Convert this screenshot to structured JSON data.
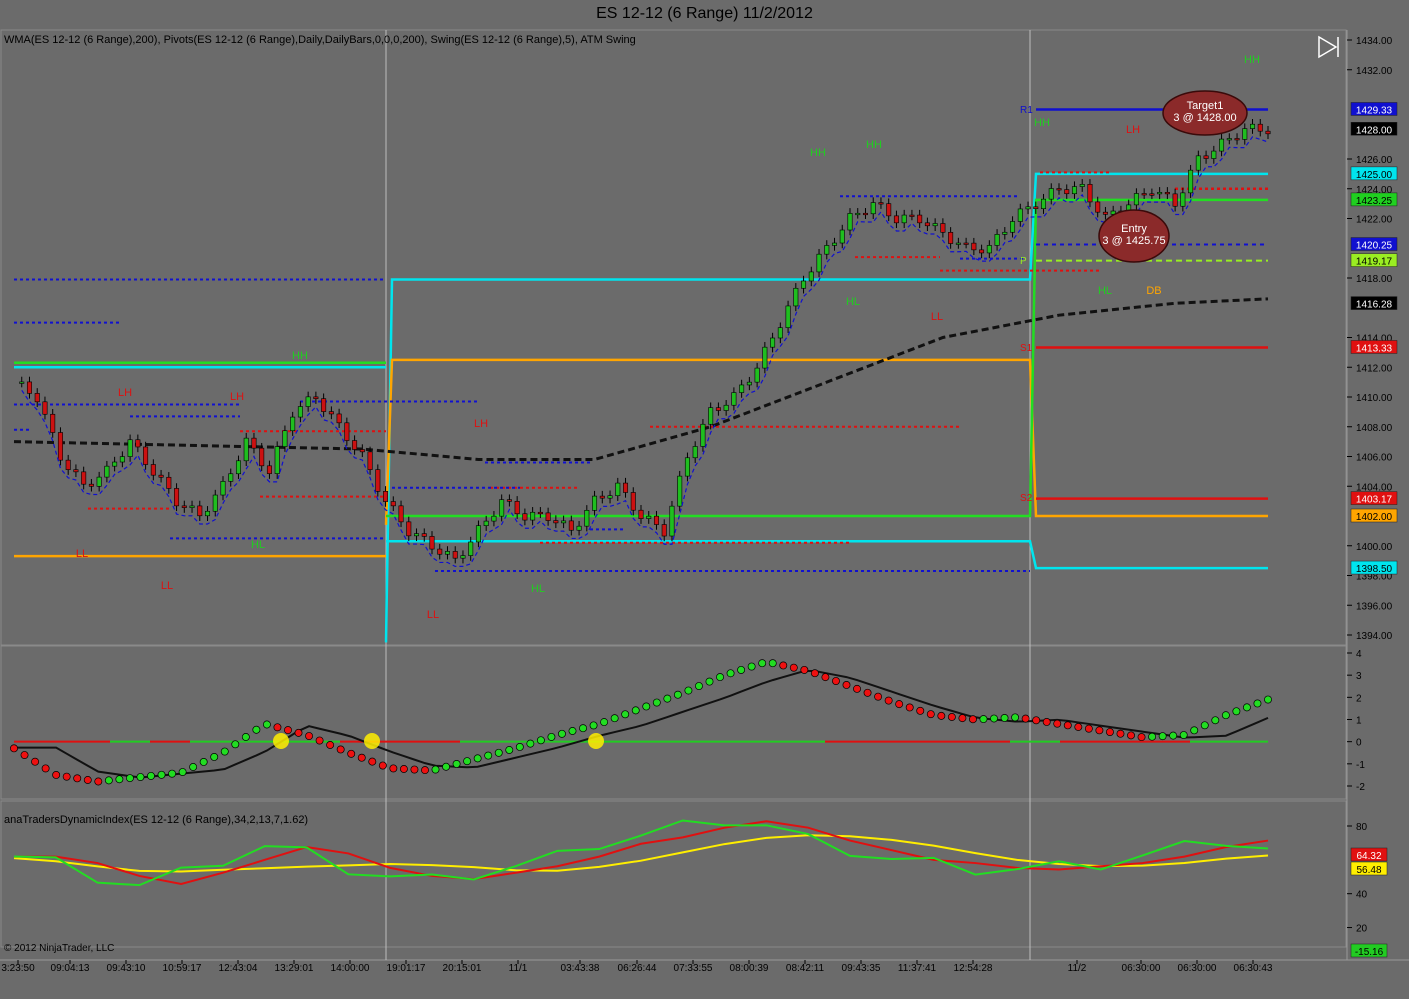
{
  "window": {
    "title": "ES 12-12 (6 Range)  11/2/2012"
  },
  "panel1": {
    "indicator_label": "WMA(ES 12-12 (6 Range),200), Pivots(ES 12-12 (6 Range),Daily,DailyBars,0,0,0,200), Swing(ES 12-12 (6 Range),5), ATM Swing",
    "price_ticks": [
      "1434.00",
      "1432.00",
      "1426.00",
      "1424.00",
      "1422.00",
      "1418.00",
      "1414.00",
      "1412.00",
      "1410.00",
      "1408.00",
      "1406.00",
      "1404.00",
      "1400.00",
      "1398.00",
      "1396.00",
      "1394.00"
    ],
    "price_ticks_values": [
      1434,
      1432,
      1426,
      1424,
      1422,
      1418,
      1414,
      1412,
      1410,
      1408,
      1406,
      1404,
      1400,
      1398,
      1396,
      1394
    ],
    "price_labels": [
      {
        "text": "1429.33",
        "value": 1429.33,
        "color": "#1010d0",
        "fg": "#ffffff"
      },
      {
        "text": "1428.00",
        "value": 1428.0,
        "color": "#000000",
        "fg": "#ffffff"
      },
      {
        "text": "1425.00",
        "value": 1425.0,
        "color": "#00e5ee",
        "fg": "#000000"
      },
      {
        "text": "1423.25",
        "value": 1423.25,
        "color": "#20d020",
        "fg": "#000000"
      },
      {
        "text": "1420.25",
        "value": 1420.25,
        "color": "#1010d0",
        "fg": "#ffffff"
      },
      {
        "text": "1419.17",
        "value": 1419.17,
        "color": "#9aee22",
        "fg": "#000000"
      },
      {
        "text": "1416.28",
        "value": 1416.28,
        "color": "#000000",
        "fg": "#ffffff"
      },
      {
        "text": "1413.33",
        "value": 1413.33,
        "color": "#e01010",
        "fg": "#ffffff"
      },
      {
        "text": "1403.17",
        "value": 1403.17,
        "color": "#e01010",
        "fg": "#ffffff"
      },
      {
        "text": "1402.00",
        "value": 1402.0,
        "color": "#ffa500",
        "fg": "#000000"
      },
      {
        "text": "1398.50",
        "value": 1398.5,
        "color": "#00e5ee",
        "fg": "#000000"
      }
    ],
    "swing_labels": [
      {
        "text": "HH",
        "color": "#22cc22"
      },
      {
        "text": "HH",
        "color": "#22cc22"
      },
      {
        "text": "HH",
        "color": "#22cc22"
      },
      {
        "text": "HH",
        "color": "#22cc22"
      },
      {
        "text": "HH",
        "color": "#22cc22"
      },
      {
        "text": "HL",
        "color": "#22cc22"
      },
      {
        "text": "HL",
        "color": "#22cc22"
      },
      {
        "text": "HL",
        "color": "#22cc22"
      },
      {
        "text": "HL",
        "color": "#22cc22"
      },
      {
        "text": "LH",
        "color": "#dd1111"
      },
      {
        "text": "LH",
        "color": "#dd1111"
      },
      {
        "text": "LH",
        "color": "#dd1111"
      },
      {
        "text": "LH",
        "color": "#dd1111"
      },
      {
        "text": "LL",
        "color": "#dd1111"
      },
      {
        "text": "LL",
        "color": "#dd1111"
      },
      {
        "text": "LL",
        "color": "#dd1111"
      },
      {
        "text": "LL",
        "color": "#dd1111"
      },
      {
        "text": "DB",
        "color": "#ffa500"
      }
    ],
    "pivot_tags": [
      "R1",
      "P",
      "S1",
      "S2"
    ],
    "target": {
      "line1": "Target1",
      "line2": "3 @ 1428.00"
    },
    "entry": {
      "line1": "Entry",
      "line2": "3 @ 1425.75"
    },
    "copyright": "© 2012 NinjaTrader, LLC"
  },
  "panel2": {
    "ticks": [
      "4",
      "3",
      "2",
      "1",
      "0",
      "-1",
      "-2"
    ]
  },
  "panel3": {
    "indicator_label": "anaTradersDynamicIndex(ES 12-12 (6 Range),34,2,13,7,1.62)",
    "ticks": [
      "80",
      "40",
      "20"
    ],
    "value_labels": [
      {
        "text": "64.32",
        "color": "#e01010",
        "fg": "#ffffff"
      },
      {
        "text": "56.48",
        "color": "#ffee00",
        "fg": "#000000"
      },
      {
        "text": "-15.16",
        "color": "#22cc22",
        "fg": "#000000"
      }
    ]
  },
  "x_axis": {
    "labels": [
      "3:23:50",
      "09:04:13",
      "09:43:10",
      "10:59:17",
      "12:43:04",
      "13:29:01",
      "14:00:00",
      "19:01:17",
      "20:15:01",
      "11/1",
      "03:43:38",
      "06:26:44",
      "07:33:55",
      "08:00:39",
      "08:42:11",
      "09:43:35",
      "11:37:41",
      "12:54:28",
      "11/2",
      "06:30:00",
      "06:30:00",
      "06:30:43"
    ]
  },
  "chart_data": {
    "type": "candlestick",
    "title": "ES 12-12 (6 Range)  11/2/2012",
    "y_range": [
      1393,
      1435
    ],
    "x_labels": [
      "3:23:50",
      "09:04:13",
      "09:43:10",
      "10:59:17",
      "12:43:04",
      "13:29:01",
      "14:00:00",
      "19:01:17",
      "20:15:01",
      "11/1",
      "03:43:38",
      "06:26:44",
      "07:33:55",
      "08:00:39",
      "08:42:11",
      "09:43:35",
      "11:37:41",
      "12:54:28",
      "11/2",
      "06:30:00",
      "06:30:00",
      "06:30:43"
    ],
    "price_path": [
      [
        0,
        1411
      ],
      [
        3,
        1410
      ],
      [
        6,
        1406
      ],
      [
        9,
        1404
      ],
      [
        12,
        1405
      ],
      [
        15,
        1407
      ],
      [
        18,
        1405
      ],
      [
        21,
        1403
      ],
      [
        24,
        1402
      ],
      [
        27,
        1404
      ],
      [
        30,
        1407
      ],
      [
        33,
        1405
      ],
      [
        36,
        1409
      ],
      [
        39,
        1410
      ],
      [
        42,
        1408
      ],
      [
        45,
        1406
      ],
      [
        48,
        1403
      ],
      [
        51,
        1401
      ],
      [
        54,
        1400
      ],
      [
        57,
        1399
      ],
      [
        60,
        1401
      ],
      [
        63,
        1403
      ],
      [
        66,
        1402
      ],
      [
        69,
        1402
      ],
      [
        72,
        1401
      ],
      [
        75,
        1403
      ],
      [
        78,
        1404
      ],
      [
        81,
        1402
      ],
      [
        84,
        1401
      ],
      [
        87,
        1406
      ],
      [
        90,
        1409
      ],
      [
        93,
        1410
      ],
      [
        96,
        1412
      ],
      [
        99,
        1415
      ],
      [
        102,
        1418
      ],
      [
        105,
        1420
      ],
      [
        108,
        1422
      ],
      [
        111,
        1423
      ],
      [
        114,
        1422
      ],
      [
        117,
        1422
      ],
      [
        120,
        1421
      ],
      [
        123,
        1420
      ],
      [
        126,
        1420
      ],
      [
        129,
        1422
      ],
      [
        132,
        1423
      ],
      [
        135,
        1424
      ],
      [
        138,
        1424
      ],
      [
        141,
        1422
      ],
      [
        144,
        1423
      ],
      [
        147,
        1424
      ],
      [
        150,
        1423
      ],
      [
        153,
        1426
      ],
      [
        156,
        1427
      ],
      [
        159,
        1428
      ],
      [
        162,
        1428
      ]
    ],
    "wma_200": [
      [
        0,
        1407
      ],
      [
        45,
        1406.5
      ],
      [
        60,
        1405.8
      ],
      [
        75,
        1405.8
      ],
      [
        90,
        1408
      ],
      [
        105,
        1411
      ],
      [
        120,
        1414
      ],
      [
        135,
        1415.5
      ],
      [
        150,
        1416.3
      ],
      [
        162,
        1416.6
      ]
    ],
    "pivot_levels": {
      "R1": 1429.33,
      "PP": 1419.17,
      "S1": 1413.33,
      "S2": 1403.17
    },
    "session_levels": {
      "cyan_high": 1425.0,
      "green": 1423.25,
      "orange": 1402.0,
      "cyan_low": 1398.5
    },
    "orders": {
      "target": 1428.0,
      "entry": 1425.75
    },
    "oscillator": {
      "range": [
        -2.5,
        4.3
      ],
      "values": [
        -0.3,
        -1.5,
        -1.8,
        -1.6,
        -1.4,
        -0.5,
        0.8,
        0.3,
        -0.5,
        -1.2,
        -1.3,
        -0.8,
        -0.3,
        0.3,
        0.8,
        1.5,
        2.2,
        3.0,
        3.6,
        3.2,
        2.5,
        1.8,
        1.2,
        1.0,
        1.1,
        0.8,
        0.5,
        0.2,
        0.3,
        1.2,
        1.9
      ]
    },
    "dynamic_index": {
      "range": [
        15,
        90
      ],
      "last": {
        "red": 64.32,
        "yellow": 56.48,
        "green": -15.16
      }
    }
  }
}
